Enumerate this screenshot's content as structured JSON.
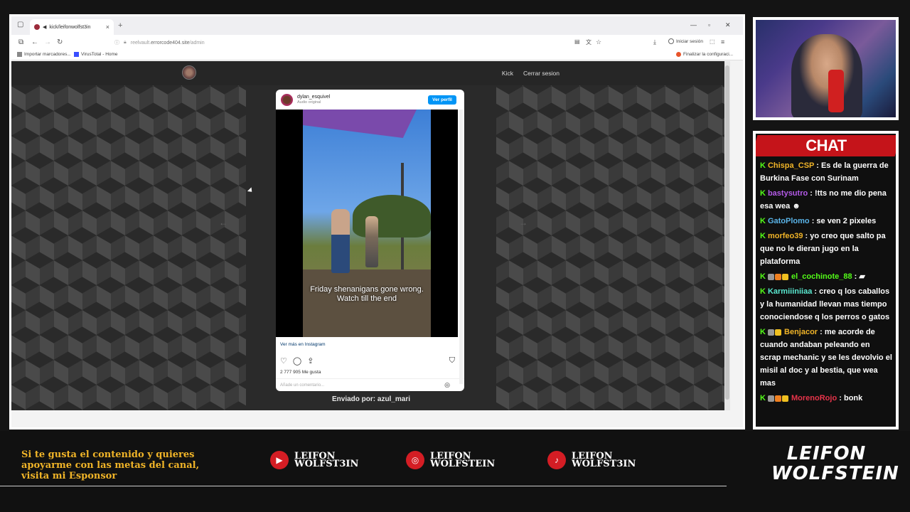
{
  "browser": {
    "tab_title": "kick/leifonwolfst3in",
    "url_prefix": "reelvault.",
    "url_domain": "errorcode404.site",
    "url_path": "/admin",
    "signin_label": "Iniciar sesión",
    "bookmarks": [
      {
        "label": "Importar marcadores..."
      },
      {
        "label": "VirusTotal - Home"
      }
    ],
    "bookmark_right": "Finalizar la configuraci..."
  },
  "site": {
    "nav": [
      "Kick",
      "Cerrar sesion"
    ],
    "submitted_by": "Enviado por: azul_mari"
  },
  "instagram": {
    "username": "dylan_esquivel",
    "audio": "Audio original",
    "follow_label": "Ver perfil",
    "caption_line1": "Friday shenanigans gone wrong.",
    "caption_line2": "Watch till the end",
    "more_link": "Ver más en Instagram",
    "likes": "2 777 905 Me gusta",
    "comment_placeholder": "Añade un comentario..."
  },
  "chat": {
    "title": "CHAT",
    "messages": [
      {
        "user": "Chispa_CSP",
        "color": "#f0b428",
        "text": ": Es de la guerra de Burkina Fase con Surinam"
      },
      {
        "user": "bastysutro",
        "color": "#b45ae8",
        "text": ": !tts no me dio pena esa wea"
      },
      {
        "user": "GatoPlomo",
        "color": "#5ab4e8",
        "text": ": se ven 2 pixeles"
      },
      {
        "user": "morfeo39",
        "color": "#f0b428",
        "text": ": yo creo que salto pa que no le dieran jugo en la plataforma"
      },
      {
        "user": "el_cochinote_88",
        "color": "#53fc18",
        "text": ":"
      },
      {
        "user": "Karmiiiniiaa",
        "color": "#5ae8d0",
        "text": ": creo q los caballos y la humanidad llevan mas tiempo conociendose q los perros o gatos"
      },
      {
        "user": "Benjacor",
        "color": "#f0b428",
        "text": ": me acorde de cuando andaban peleando en scrap mechanic y se les devolvio el misil al doc y al bestia, que wea mas"
      },
      {
        "user": "MorenoRojo",
        "color": "#e8344a",
        "text": ": bonk"
      }
    ]
  },
  "footer": {
    "sponsor_text": "Si te gusta el contenido y quieres apoyarme con las metas del canal, visita mi Esponsor",
    "socials": [
      {
        "icon": "youtube-icon",
        "line1": "LEIFON",
        "line2": "WOLFST3IN"
      },
      {
        "icon": "instagram-icon",
        "line1": "LEIFON",
        "line2": "WOLFSTEIN"
      },
      {
        "icon": "tiktok-icon",
        "line1": "LEIFON",
        "line2": "WOLFST3IN"
      }
    ],
    "logo_line1": "LEIFON",
    "logo_line2": "WOLFSTEIN"
  },
  "colors": {
    "accent_red": "#c5141a",
    "kick_green": "#53fc18",
    "sponsor_gold": "#f0b428"
  }
}
